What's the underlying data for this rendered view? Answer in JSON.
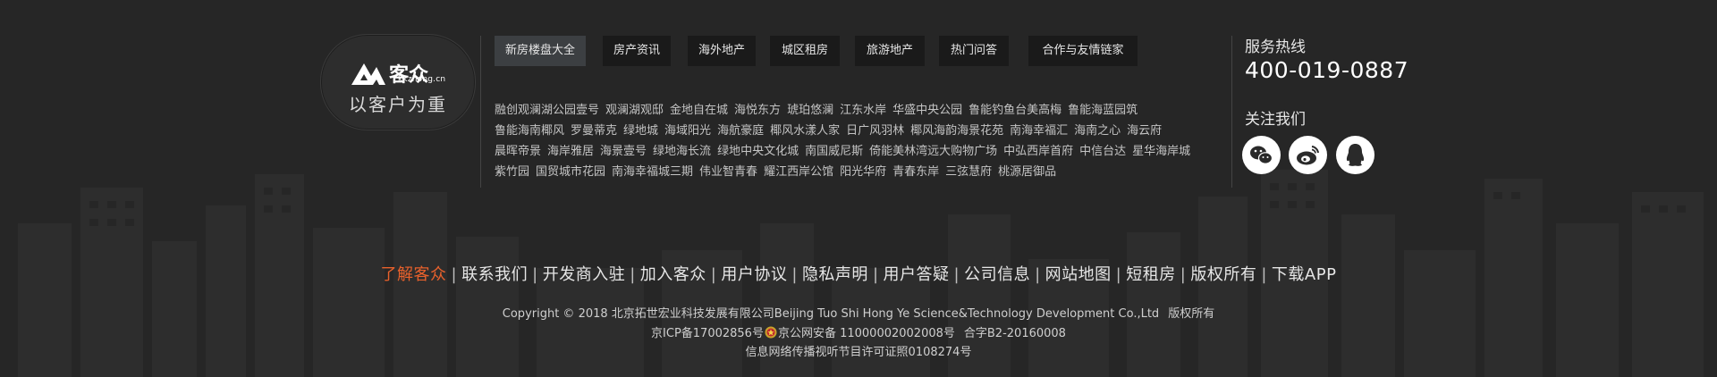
{
  "logo": {
    "brand": "客众",
    "domain": "kkzhong.cn",
    "slogan": "以客户为重"
  },
  "tabs": [
    {
      "label": "新房楼盘大全",
      "active": true
    },
    {
      "label": "房产资讯",
      "active": false
    },
    {
      "label": "海外地产",
      "active": false
    },
    {
      "label": "城区租房",
      "active": false
    },
    {
      "label": "旅游地产",
      "active": false
    },
    {
      "label": "热门问答",
      "active": false
    },
    {
      "label": "合作与友情链家",
      "active": false
    }
  ],
  "properties": [
    "融创观澜湖公园壹号",
    "观澜湖观邸",
    "金地自在城",
    "海悦东方",
    "琥珀悠澜",
    "江东水岸",
    "华盛中央公园",
    "鲁能钓鱼台美高梅",
    "鲁能海蓝园筑",
    "鲁能海南椰风",
    "罗曼蒂克",
    "绿地城",
    "海域阳光",
    "海航豪庭",
    "椰风水漾人家",
    "日广风羽林",
    "椰风海韵海景花苑",
    "南海幸福汇",
    "海南之心",
    "海云府",
    "晨晖帝景",
    "海岸雅居",
    "海景壹号",
    "绿地海长流",
    "绿地中央文化城",
    "南国威尼斯",
    "倚能美林湾远大购物广场",
    "中弘西岸首府",
    "中信台达",
    "星华海岸城",
    "紫竹园",
    "国贸城市花园",
    "南海幸福城三期",
    "伟业智青春",
    "耀江西岸公馆",
    "阳光华府",
    "青春东岸",
    "三弦慧府",
    "桃源居御品"
  ],
  "service": {
    "hotline_label": "服务热线",
    "hotline_number": "400-019-0887",
    "follow_label": "关注我们",
    "social_icons": [
      "wechat-icon",
      "weibo-icon",
      "qq-icon"
    ]
  },
  "footer": {
    "links": [
      "了解客众",
      "联系我们",
      "开发商入驻",
      "加入客众",
      "用户协议",
      "隐私声明",
      "用户答疑",
      "公司信息",
      "网站地图",
      "短租房",
      "版权所有",
      "下载APP"
    ],
    "highlight_color": "#e8612c",
    "copyright_line": "Copyright © 2018 北京拓世宏业科技发展有限公司Beijing Tuo Shi Hong Ye Science&Technology Development Co.,Ltd",
    "rights": "版权所有",
    "icp": "京ICP备17002856号",
    "police_record": "京公网安备 11000002002008号",
    "b2_license": "合字B2-20160008",
    "av_license": "信息网络传播视听节目许可证照0108274号"
  },
  "colors": {
    "background": "#262626",
    "tab_bg": "#1a1a1a",
    "tab_active_bg": "#3c3f42",
    "text": "#e6e6e6",
    "accent": "#e8612c"
  }
}
